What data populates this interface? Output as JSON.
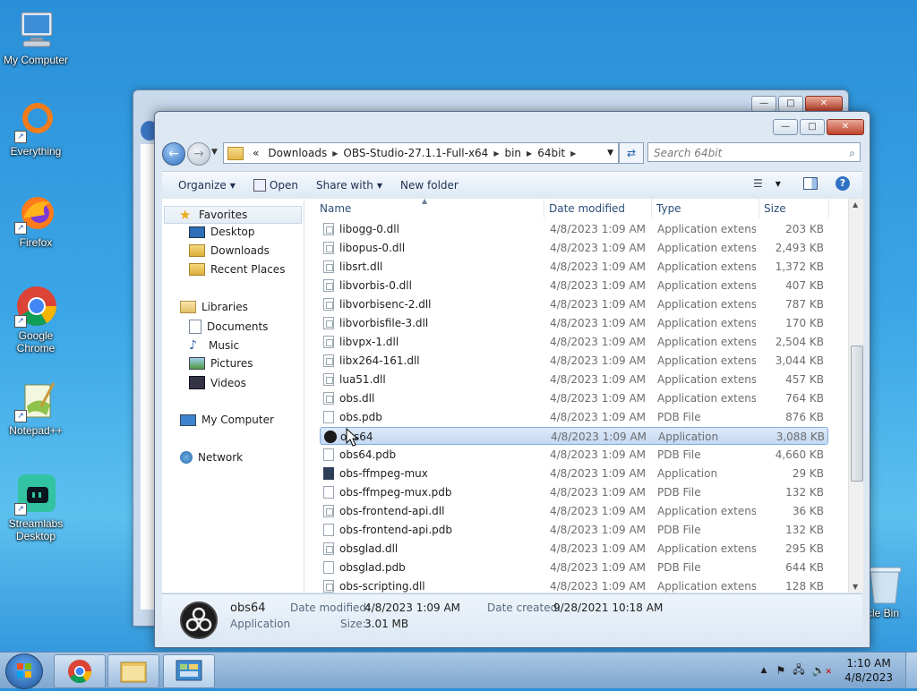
{
  "desktop": {
    "icons": [
      {
        "label": "My Computer",
        "icon": "computer-icon"
      },
      {
        "label": "Everything",
        "icon": "everything-icon"
      },
      {
        "label": "Firefox",
        "icon": "firefox-icon"
      },
      {
        "label": "Google Chrome",
        "icon": "chrome-icon"
      },
      {
        "label": "Notepad++",
        "icon": "notepadpp-icon"
      },
      {
        "label": "Streamlabs Desktop",
        "icon": "streamlabs-icon"
      },
      {
        "label": "cle Bin",
        "icon": "recycle-bin-icon"
      }
    ]
  },
  "window": {
    "caption": {
      "minimize": "—",
      "maximize": "□",
      "close": "✕"
    },
    "address": {
      "prefix": "«",
      "crumbs": [
        "Downloads",
        "OBS-Studio-27.1.1-Full-x64",
        "bin",
        "64bit"
      ]
    },
    "search_placeholder": "Search 64bit",
    "toolbar": {
      "organize": "Organize",
      "open": "Open",
      "share_with": "Share with",
      "new_folder": "New folder"
    },
    "nav": {
      "favorites": "Favorites",
      "desktop": "Desktop",
      "downloads": "Downloads",
      "recent_places": "Recent Places",
      "libraries": "Libraries",
      "documents": "Documents",
      "music": "Music",
      "pictures": "Pictures",
      "videos": "Videos",
      "my_computer": "My Computer",
      "network": "Network"
    },
    "columns": {
      "name": "Name",
      "date": "Date modified",
      "type": "Type",
      "size": "Size"
    },
    "files": [
      {
        "name": "libogg-0.dll",
        "date": "4/8/2023 1:09 AM",
        "type": "Application extens...",
        "size": "203 KB",
        "kind": "dll"
      },
      {
        "name": "libopus-0.dll",
        "date": "4/8/2023 1:09 AM",
        "type": "Application extens...",
        "size": "2,493 KB",
        "kind": "dll"
      },
      {
        "name": "libsrt.dll",
        "date": "4/8/2023 1:09 AM",
        "type": "Application extens...",
        "size": "1,372 KB",
        "kind": "dll"
      },
      {
        "name": "libvorbis-0.dll",
        "date": "4/8/2023 1:09 AM",
        "type": "Application extens...",
        "size": "407 KB",
        "kind": "dll"
      },
      {
        "name": "libvorbisenc-2.dll",
        "date": "4/8/2023 1:09 AM",
        "type": "Application extens...",
        "size": "787 KB",
        "kind": "dll"
      },
      {
        "name": "libvorbisfile-3.dll",
        "date": "4/8/2023 1:09 AM",
        "type": "Application extens...",
        "size": "170 KB",
        "kind": "dll"
      },
      {
        "name": "libvpx-1.dll",
        "date": "4/8/2023 1:09 AM",
        "type": "Application extens...",
        "size": "2,504 KB",
        "kind": "dll"
      },
      {
        "name": "libx264-161.dll",
        "date": "4/8/2023 1:09 AM",
        "type": "Application extens...",
        "size": "3,044 KB",
        "kind": "dll"
      },
      {
        "name": "lua51.dll",
        "date": "4/8/2023 1:09 AM",
        "type": "Application extens...",
        "size": "457 KB",
        "kind": "dll"
      },
      {
        "name": "obs.dll",
        "date": "4/8/2023 1:09 AM",
        "type": "Application extens...",
        "size": "764 KB",
        "kind": "dll"
      },
      {
        "name": "obs.pdb",
        "date": "4/8/2023 1:09 AM",
        "type": "PDB File",
        "size": "876 KB",
        "kind": "pdb"
      },
      {
        "name": "obs64",
        "date": "4/8/2023 1:09 AM",
        "type": "Application",
        "size": "3,088 KB",
        "kind": "obs",
        "selected": true
      },
      {
        "name": "obs64.pdb",
        "date": "4/8/2023 1:09 AM",
        "type": "PDB File",
        "size": "4,660 KB",
        "kind": "pdb"
      },
      {
        "name": "obs-ffmpeg-mux",
        "date": "4/8/2023 1:09 AM",
        "type": "Application",
        "size": "29 KB",
        "kind": "exe"
      },
      {
        "name": "obs-ffmpeg-mux.pdb",
        "date": "4/8/2023 1:09 AM",
        "type": "PDB File",
        "size": "132 KB",
        "kind": "pdb"
      },
      {
        "name": "obs-frontend-api.dll",
        "date": "4/8/2023 1:09 AM",
        "type": "Application extens...",
        "size": "36 KB",
        "kind": "dll"
      },
      {
        "name": "obs-frontend-api.pdb",
        "date": "4/8/2023 1:09 AM",
        "type": "PDB File",
        "size": "132 KB",
        "kind": "pdb"
      },
      {
        "name": "obsglad.dll",
        "date": "4/8/2023 1:09 AM",
        "type": "Application extens...",
        "size": "295 KB",
        "kind": "dll"
      },
      {
        "name": "obsglad.pdb",
        "date": "4/8/2023 1:09 AM",
        "type": "PDB File",
        "size": "644 KB",
        "kind": "pdb"
      },
      {
        "name": "obs-scripting.dll",
        "date": "4/8/2023 1:09 AM",
        "type": "Application extens...",
        "size": "128 KB",
        "kind": "dll"
      }
    ],
    "details": {
      "name": "obs64",
      "type": "Application",
      "date_modified_label": "Date modified:",
      "date_modified": "4/8/2023 1:09 AM",
      "size_label": "Size:",
      "size": "3.01 MB",
      "date_created_label": "Date created:",
      "date_created": "9/28/2021 10:18 AM"
    }
  },
  "taskbar": {
    "time": "1:10 AM",
    "date": "4/8/2023"
  }
}
